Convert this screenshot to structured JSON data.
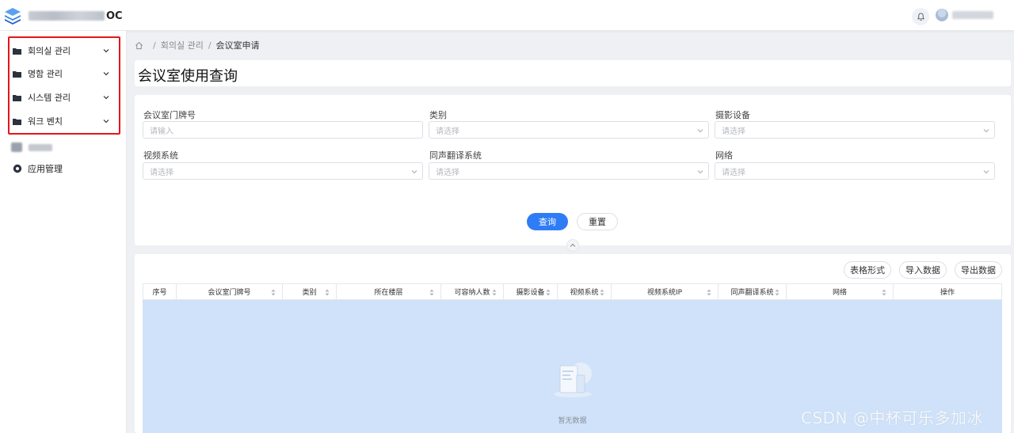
{
  "header": {
    "app_suffix": "OC"
  },
  "sidebar": {
    "items": [
      {
        "label": "회의실 관리"
      },
      {
        "label": "명함 관리"
      },
      {
        "label": "시스템 관리"
      },
      {
        "label": "워크 벤치"
      }
    ],
    "app_management": "应用管理"
  },
  "breadcrumb": {
    "parent": "회의실 관리",
    "separator": "/",
    "current": "会议室申请"
  },
  "page": {
    "title": "会议室使用查询"
  },
  "filters": {
    "room_no": {
      "label": "会议室门牌号",
      "placeholder": "请输入"
    },
    "category": {
      "label": "类别",
      "placeholder": "请选择"
    },
    "camera": {
      "label": "摄影设备",
      "placeholder": "请选择"
    },
    "video_system": {
      "label": "视频系统",
      "placeholder": "请选择"
    },
    "translation": {
      "label": "同声翻译系统",
      "placeholder": "请选择"
    },
    "network": {
      "label": "网络",
      "placeholder": "请选择"
    },
    "query_label": "查询",
    "reset_label": "重置"
  },
  "toolbar": {
    "table_form": "表格形式",
    "import": "导入数据",
    "export": "导出数据"
  },
  "table": {
    "columns": [
      "序号",
      "会议室门牌号",
      "类别",
      "所在楼层",
      "可容纳人数",
      "摄影设备",
      "视频系统",
      "视频系统IP",
      "同声翻译系统",
      "网络",
      "操作"
    ],
    "empty_text": "暂无数据"
  },
  "watermark": "CSDN @中杯可乐多加冰",
  "colors": {
    "primary": "#2f7df6",
    "highlight_border": "#e8141a",
    "table_body": "#cfe2fa"
  }
}
